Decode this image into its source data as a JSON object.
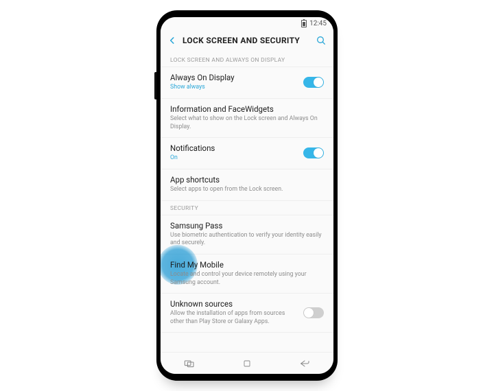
{
  "status": {
    "time": "12:45"
  },
  "header": {
    "title": "LOCK SCREEN AND SECURITY"
  },
  "sections": {
    "lockscreen_label": "LOCK SCREEN AND ALWAYS ON DISPLAY",
    "security_label": "SECURITY"
  },
  "rows": {
    "aod": {
      "title": "Always On Display",
      "sub": "Show always",
      "toggled": true
    },
    "facewidgets": {
      "title": "Information and FaceWidgets",
      "sub": "Select what to show on the Lock screen and Always On Display."
    },
    "notifications": {
      "title": "Notifications",
      "sub": "On",
      "toggled": true
    },
    "shortcuts": {
      "title": "App shortcuts",
      "sub": "Select apps to open from the Lock screen."
    },
    "samsungpass": {
      "title": "Samsung Pass",
      "sub": "Use biometric authentication to verify your identity easily and securely."
    },
    "findmymobile": {
      "title": "Find My Mobile",
      "sub": "Locate and control your device remotely using your Samsung account."
    },
    "unknown": {
      "title": "Unknown sources",
      "sub": "Allow the installation of apps from sources other than Play Store or Galaxy Apps.",
      "toggled": false
    }
  },
  "colors": {
    "accent": "#2aa7d8"
  }
}
